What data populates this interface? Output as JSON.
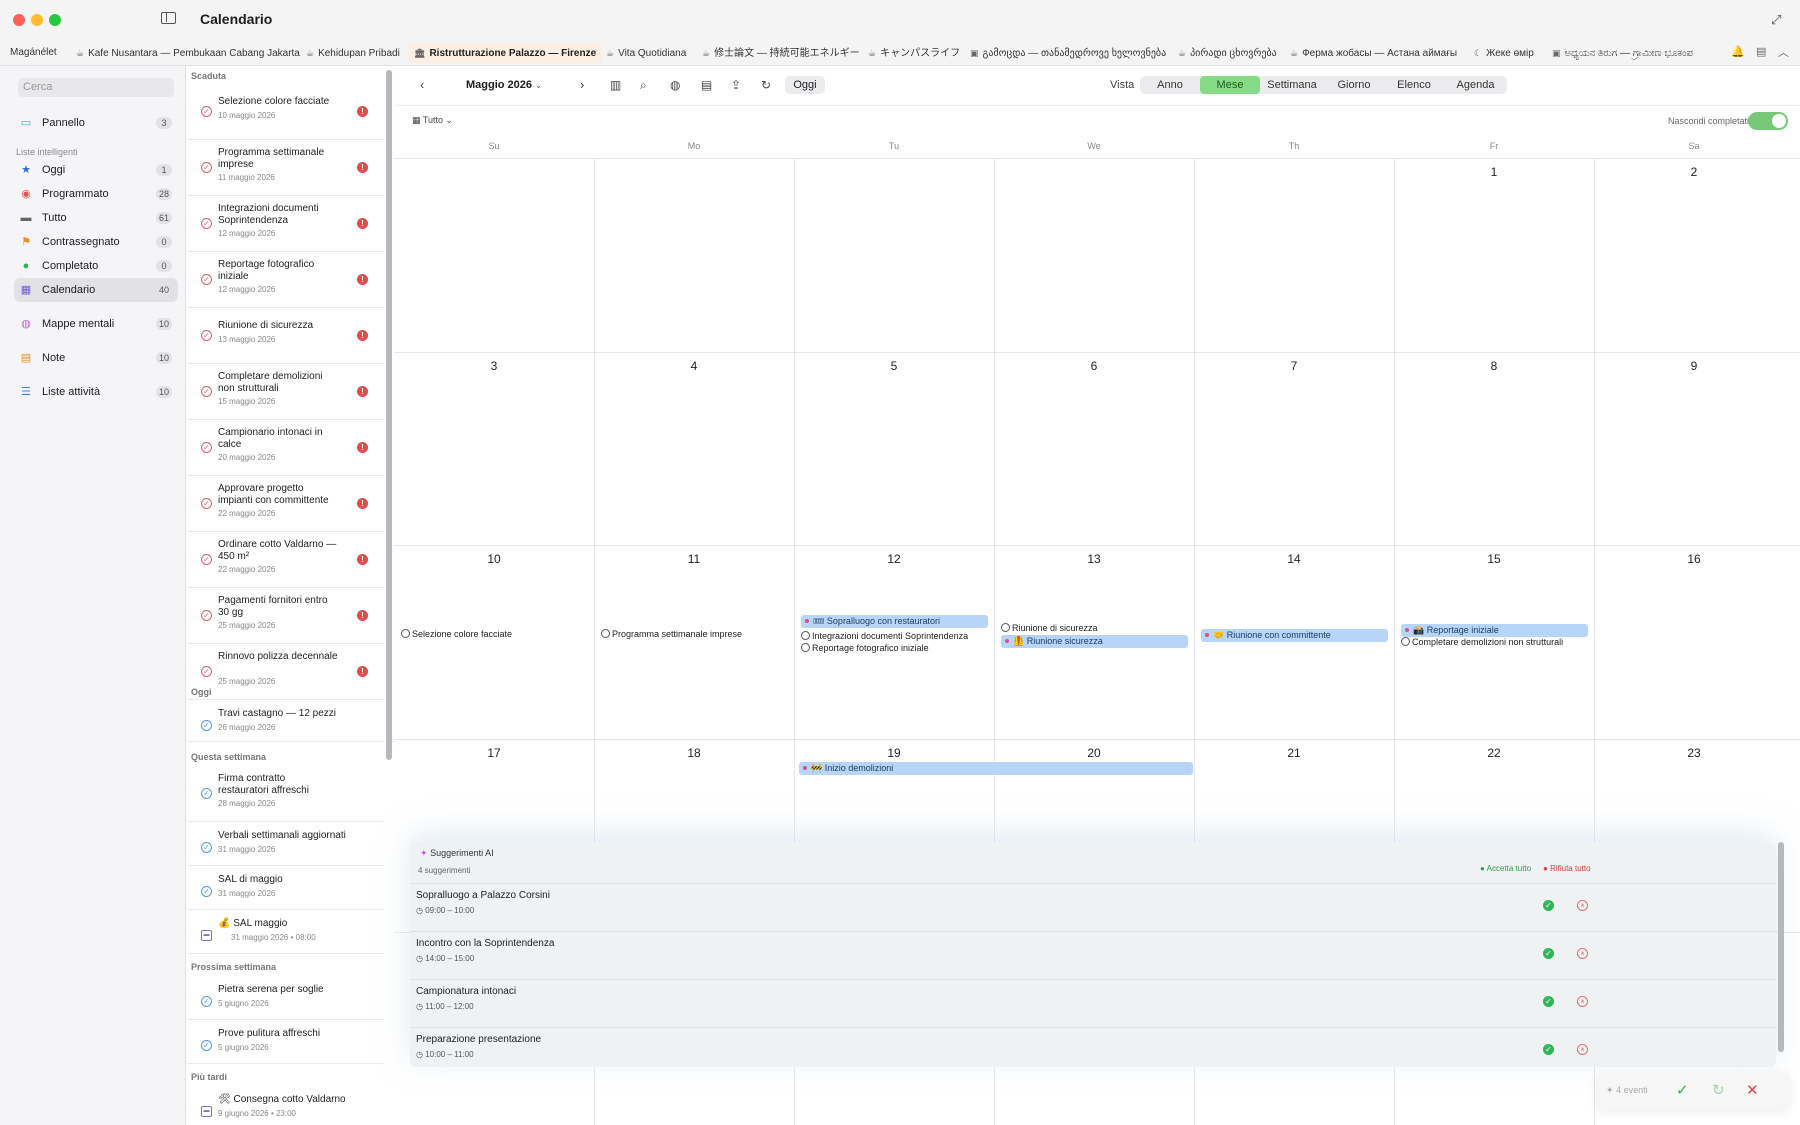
{
  "window": {
    "title": "Calendario"
  },
  "tabs": [
    {
      "icon": "",
      "label": "Magánélet"
    },
    {
      "icon": "☕",
      "label": "Kafe Nusantara — Pembukaan Cabang Jakarta"
    },
    {
      "icon": "☕",
      "label": "Kehidupan Pribadi"
    },
    {
      "icon": "🏛",
      "label": "Ristrutturazione Palazzo — Firenze"
    },
    {
      "icon": "☕",
      "label": "Vita Quotidiana"
    },
    {
      "icon": "☕",
      "label": "修士論文 — 持続可能エネルギー"
    },
    {
      "icon": "☕",
      "label": "キャンパスライフ"
    },
    {
      "icon": "▣",
      "label": "გამოცდა — თანამედროვე ხელოვნება"
    },
    {
      "icon": "☕",
      "label": "პირადი ცხოვრება"
    },
    {
      "icon": "☕",
      "label": "Ферма жобасы — Астана аймағы"
    },
    {
      "icon": "☾",
      "label": "Жеке өмір"
    },
    {
      "icon": "▣",
      "label": "ಅಧ್ಯಯನ ತಿರುಗ — ಗ್ರಾಮೀಣ ಭೂಕಂಪ"
    }
  ],
  "sidebar": {
    "search_placeholder": "Cerca",
    "top": {
      "label": "Pannello",
      "count": "3"
    },
    "section": "Liste intelligenti",
    "items": [
      {
        "label": "Oggi",
        "count": "1"
      },
      {
        "label": "Programmato",
        "count": "28"
      },
      {
        "label": "Tutto",
        "count": "61"
      },
      {
        "label": "Contrassegnato",
        "count": "0"
      },
      {
        "label": "Completato",
        "count": "0"
      },
      {
        "label": "Calendario",
        "count": "40"
      }
    ],
    "extra": [
      {
        "label": "Mappe mentali",
        "count": "10"
      },
      {
        "label": "Note",
        "count": "10"
      },
      {
        "label": "Liste attività",
        "count": "10"
      }
    ]
  },
  "tasklist": {
    "groups": {
      "overdue": "Scaduta",
      "today": "Oggi",
      "week": "Questa settimana",
      "next": "Prossima settimana",
      "later": "Più tardi"
    },
    "overdue": [
      {
        "title": "Selezione colore facciate",
        "date": "10 maggio 2026"
      },
      {
        "title": "Programma settimanale imprese",
        "date": "11 maggio 2026"
      },
      {
        "title": "Integrazioni documenti Soprintendenza",
        "date": "12 maggio 2026"
      },
      {
        "title": "Reportage fotografico iniziale",
        "date": "12 maggio 2026"
      },
      {
        "title": "Riunione di sicurezza",
        "date": "13 maggio 2026"
      },
      {
        "title": "Completare demolizioni non strutturali",
        "date": "15 maggio 2026"
      },
      {
        "title": "Campionario intonaci in calce",
        "date": "20 maggio 2026"
      },
      {
        "title": "Approvare progetto impianti con committente",
        "date": "22 maggio 2026"
      },
      {
        "title": "Ordinare cotto Valdarno — 450 m²",
        "date": "22 maggio 2026"
      },
      {
        "title": "Pagamenti fornitori entro 30 gg",
        "date": "25 maggio 2026"
      },
      {
        "title": "Rinnovo polizza decennale",
        "date": "25 maggio 2026"
      }
    ],
    "today": [
      {
        "title": "Travi castagno — 12 pezzi",
        "date": "26 maggio 2026"
      }
    ],
    "week": [
      {
        "title": "Firma contratto restauratori affreschi",
        "date": "28 maggio 2026"
      },
      {
        "title": "Verbali settimanali aggiornati",
        "date": "31 maggio 2026"
      },
      {
        "title": "SAL di maggio",
        "date": "31 maggio 2026"
      },
      {
        "title": "💰 SAL maggio",
        "date": "31 maggio 2026 • 08:00"
      }
    ],
    "next": [
      {
        "title": "Pietra serena per soglie",
        "date": "5 giugno 2026"
      },
      {
        "title": "Prove pulitura affreschi",
        "date": "5 giugno 2026"
      }
    ],
    "later": [
      {
        "title": "🛠 Consegna cotto Valdarno",
        "date": "9 giugno 2026 • 23:00"
      }
    ]
  },
  "toolbar": {
    "month": "Maggio 2026",
    "today": "Oggi",
    "vista": "Vista",
    "views": [
      "Anno",
      "Mese",
      "Settimana",
      "Giorno",
      "Elenco",
      "Agenda"
    ],
    "filter": "Tutto",
    "hide_completed": "Nascondi completati"
  },
  "calendar": {
    "weekdays": [
      "Su",
      "Mo",
      "Tu",
      "We",
      "Th",
      "Fr",
      "Sa"
    ],
    "weeks": [
      [
        "",
        "",
        "",
        "",
        "",
        "1",
        "2"
      ],
      [
        "3",
        "4",
        "5",
        "6",
        "7",
        "8",
        "9"
      ],
      [
        "10",
        "11",
        "12",
        "13",
        "14",
        "15",
        "16"
      ],
      [
        "17",
        "18",
        "19",
        "20",
        "21",
        "22",
        "23"
      ]
    ],
    "events": {
      "e10": "Selezione colore facciate",
      "e11": "Programma settimanale imprese",
      "e12a": "🎟 Sopralluogo con restauratori",
      "e12b": "Integrazioni documenti Soprintendenza",
      "e12c": "Reportage fotografico iniziale",
      "e13a": "Riunione di sicurezza",
      "e13b": "🦺 Riunione sicurezza",
      "e14": "🤝 Riunione con committente",
      "e15a": "📸 Reportage iniziale",
      "e15b": "Completare demolizioni non strutturali",
      "e19": "🚧 Inizio demolizioni"
    }
  },
  "ai_suggestions": {
    "title": "Suggerimenti AI",
    "count": "4 suggerimenti",
    "accept_all": "Accetta tutto",
    "reject_all": "Rifiuta tutto",
    "items": [
      {
        "title": "Sopralluogo a Palazzo Corsini",
        "time": "09:00 – 10:00"
      },
      {
        "title": "Incontro con la Soprintendenza",
        "time": "14:00 – 15:00"
      },
      {
        "title": "Campionatura intonaci",
        "time": "11:00 – 12:00"
      },
      {
        "title": "Preparazione presentazione",
        "time": "10:00 – 11:00"
      }
    ]
  },
  "pending": {
    "label": "4 eventi"
  },
  "colors": {
    "accent_green": "#86dc86",
    "event_blue": "#b7d6f7",
    "overdue_red": "#e24c4c"
  }
}
